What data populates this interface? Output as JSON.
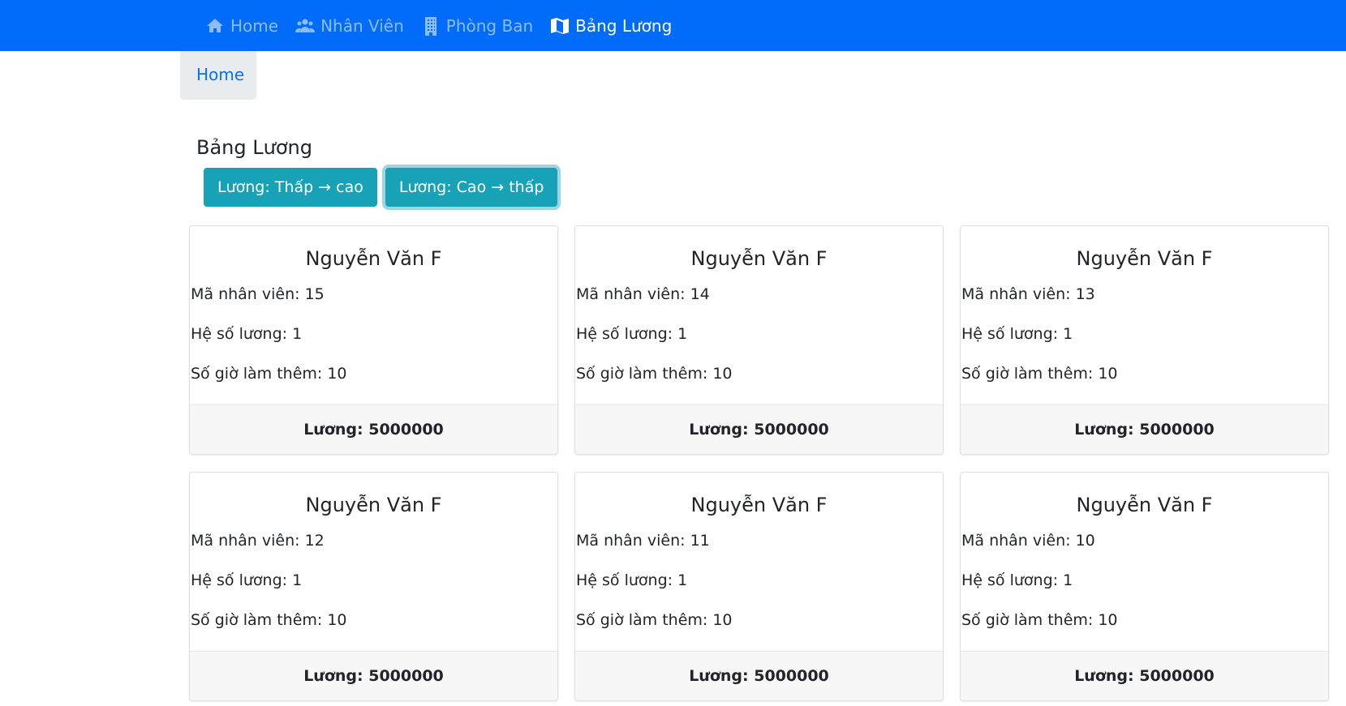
{
  "nav": {
    "items": [
      {
        "label": "Home",
        "icon": "home-icon"
      },
      {
        "label": "Nhân Viên",
        "icon": "users-icon"
      },
      {
        "label": "Phòng Ban",
        "icon": "building-icon"
      },
      {
        "label": "Bảng Lương",
        "icon": "map-icon"
      }
    ],
    "active_index": 3
  },
  "breadcrumb": {
    "home": "Home"
  },
  "page": {
    "title": "Bảng Lương",
    "sort_asc_label": "Lương: Thấp → cao",
    "sort_desc_label": "Lương: Cao → thấp"
  },
  "cards": [
    {
      "name": "Nguyễn Văn F",
      "id_line": "Mã nhân viên: 15",
      "coef_line": "Hệ số lương: 1",
      "overtime_line": "Số giờ làm thêm: 10",
      "salary_line": "Lương: 5000000"
    },
    {
      "name": "Nguyễn Văn F",
      "id_line": "Mã nhân viên: 14",
      "coef_line": "Hệ số lương: 1",
      "overtime_line": "Số giờ làm thêm: 10",
      "salary_line": "Lương: 5000000"
    },
    {
      "name": "Nguyễn Văn F",
      "id_line": "Mã nhân viên: 13",
      "coef_line": "Hệ số lương: 1",
      "overtime_line": "Số giờ làm thêm: 10",
      "salary_line": "Lương: 5000000"
    },
    {
      "name": "Nguyễn Văn F",
      "id_line": "Mã nhân viên: 12",
      "coef_line": "Hệ số lương: 1",
      "overtime_line": "Số giờ làm thêm: 10",
      "salary_line": "Lương: 5000000"
    },
    {
      "name": "Nguyễn Văn F",
      "id_line": "Mã nhân viên: 11",
      "coef_line": "Hệ số lương: 1",
      "overtime_line": "Số giờ làm thêm: 10",
      "salary_line": "Lương: 5000000"
    },
    {
      "name": "Nguyễn Văn F",
      "id_line": "Mã nhân viên: 10",
      "coef_line": "Hệ số lương: 1",
      "overtime_line": "Số giờ làm thêm: 10",
      "salary_line": "Lương: 5000000"
    }
  ],
  "colors": {
    "navbar": "#006cf9",
    "accent_button": "#17a2b8",
    "link": "#0d6efd"
  }
}
